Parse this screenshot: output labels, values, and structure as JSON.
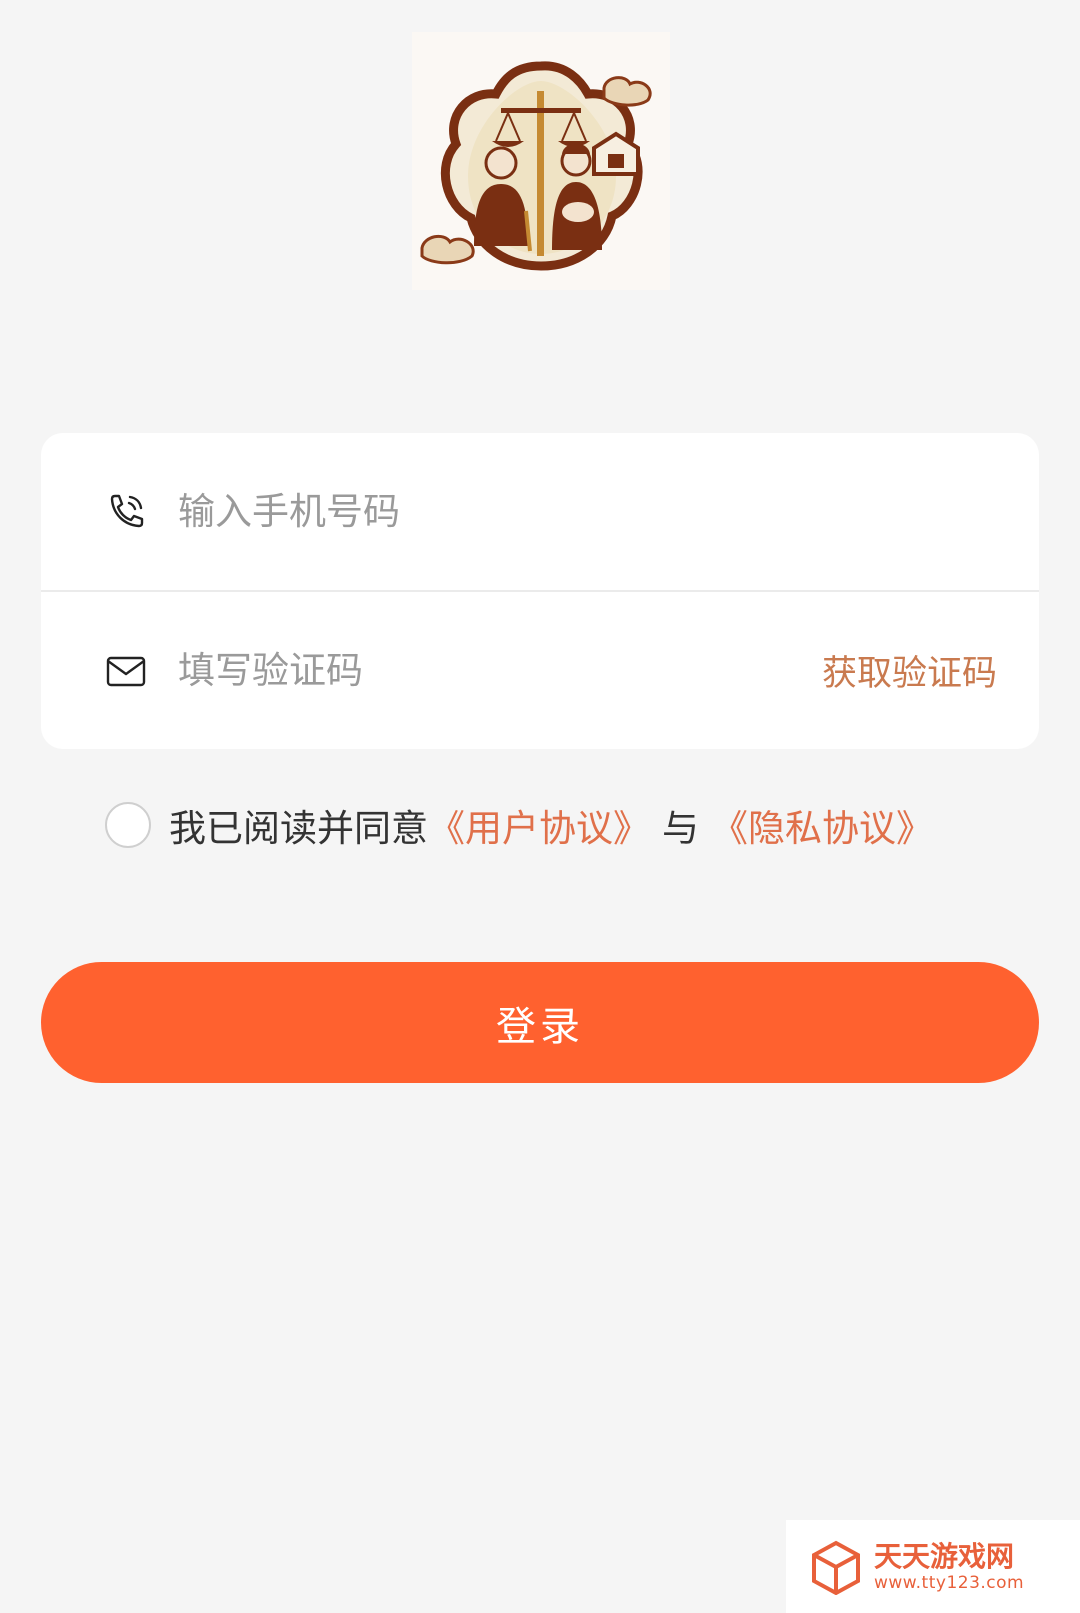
{
  "logo": {
    "icon": "family-law-scale-logo"
  },
  "form": {
    "phone": {
      "icon": "phone-icon",
      "placeholder": "输入手机号码",
      "value": ""
    },
    "code": {
      "icon": "mail-icon",
      "placeholder": "填写验证码",
      "value": "",
      "get_code_label": "获取验证码"
    }
  },
  "agreement": {
    "checked": false,
    "prefix": "我已阅读并同意",
    "user_agreement_label": "《用户协议》",
    "connector": "与",
    "privacy_agreement_label": "《隐私协议》"
  },
  "login": {
    "label": "登录"
  },
  "watermark": {
    "title": "天天游戏网",
    "url": "www.tty123.com"
  },
  "colors": {
    "accent": "#ff612f",
    "link": "#e0704a",
    "code_link": "#c97a4f",
    "background": "#f5f5f5"
  }
}
